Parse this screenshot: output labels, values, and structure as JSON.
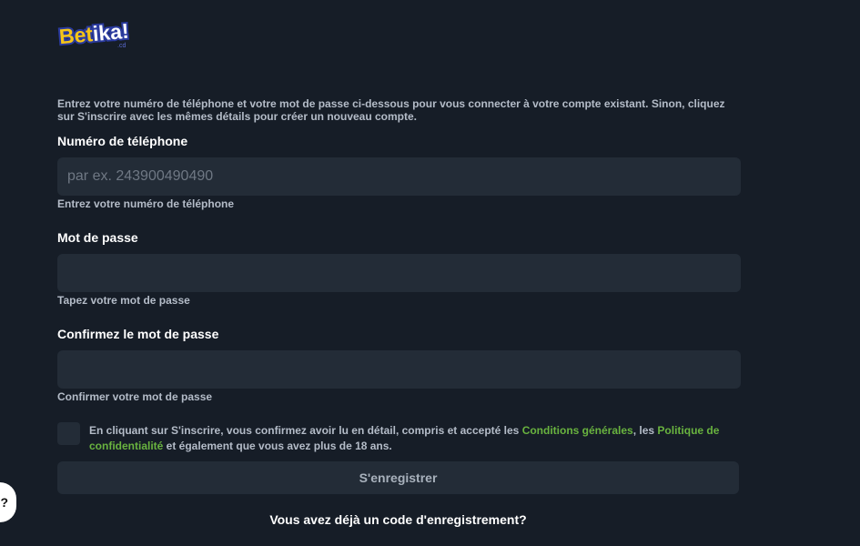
{
  "brand": {
    "logo_text_1": "Bet",
    "logo_text_2": "ika!",
    "logo_sub": ".cd"
  },
  "intro_text": "Entrez votre numéro de téléphone et votre mot de passe ci-dessous pour vous connecter à votre compte existant. Sinon, cliquez sur S'inscrire avec les mêmes détails pour créer un nouveau compte.",
  "phone": {
    "label": "Numéro de téléphone",
    "placeholder": "par ex. 243900490490",
    "value": "",
    "hint": "Entrez votre numéro de téléphone"
  },
  "password": {
    "label": "Mot de passe",
    "placeholder": "",
    "value": "",
    "hint": "Tapez votre mot de passe"
  },
  "confirm_password": {
    "label": "Confirmez le mot de passe",
    "placeholder": "",
    "value": "",
    "hint": "Confirmer votre mot de passe"
  },
  "terms": {
    "checked": false,
    "text_1": "En cliquant sur S'inscrire, vous confirmez avoir lu en détail, compris et accepté les ",
    "link_1": "Conditions générales",
    "text_2": ", les ",
    "link_2": "Politique de confidentialité",
    "text_3": " et également que vous avez plus de 18 ans."
  },
  "register_button": "S'enregistrer",
  "registration_code_link": "Vous avez déjà un code d'enregistrement?",
  "help_button": "?",
  "colors": {
    "background": "#161d27",
    "field_bg": "#232c37",
    "link": "#69b33f",
    "logo_yellow": "#f5c518",
    "logo_blue": "#3a4bb7"
  }
}
